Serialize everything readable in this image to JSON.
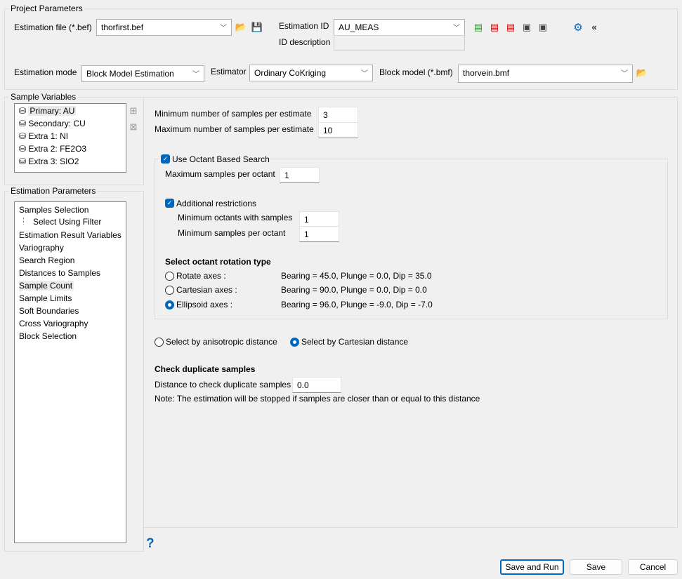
{
  "project": {
    "title": "Project Parameters",
    "estimation_file_label": "Estimation file (*.bef)",
    "estimation_file": "thorfirst.bef",
    "estimation_id_label": "Estimation ID",
    "estimation_id": "AU_MEAS",
    "id_description_label": "ID description",
    "id_description": "",
    "estimation_mode_label": "Estimation mode",
    "estimation_mode": "Block Model Estimation",
    "estimator_label": "Estimator",
    "estimator": "Ordinary CoKriging",
    "block_model_label": "Block model (*.bmf)",
    "block_model": "thorvein.bmf"
  },
  "sample_variables": {
    "title": "Sample Variables",
    "items": [
      "Primary: AU",
      "Secondary: CU",
      "Extra 1: NI",
      "Extra 2: FE2O3",
      "Extra 3: SIO2"
    ]
  },
  "estimation_parameters": {
    "title": "Estimation Parameters",
    "items": [
      "Samples Selection",
      "Select Using Filter",
      "Estimation Result Variables",
      "Variography",
      "Search Region",
      "Distances to Samples",
      "Sample Count",
      "Sample Limits",
      "Soft Boundaries",
      "Cross Variography",
      "Block Selection"
    ],
    "selected": "Sample Count"
  },
  "sample_count": {
    "min_samples_label": "Minimum number of samples per estimate",
    "min_samples": "3",
    "max_samples_label": "Maximum number of samples per estimate",
    "max_samples": "10",
    "octant_label": "Use Octant Based Search",
    "octant_checked": true,
    "max_per_octant_label": "Maximum samples per octant",
    "max_per_octant": "1",
    "additional_label": "Additional restrictions",
    "additional_checked": true,
    "min_octants_label": "Minimum octants with samples",
    "min_octants": "1",
    "min_per_octant_label": "Minimum samples per octant",
    "min_per_octant": "1",
    "rotation_heading": "Select octant rotation type",
    "rotation_options": [
      {
        "label": "Rotate axes :",
        "value": "Bearing = 45.0, Plunge = 0.0, Dip = 35.0",
        "selected": false
      },
      {
        "label": "Cartesian axes :",
        "value": "Bearing = 90.0, Plunge = 0.0, Dip = 0.0",
        "selected": false
      },
      {
        "label": "Ellipsoid axes :",
        "value": "Bearing = 96.0, Plunge = -9.0, Dip = -7.0",
        "selected": true
      }
    ],
    "distance_options": [
      {
        "label": "Select by anisotropic distance",
        "selected": false
      },
      {
        "label": "Select by Cartesian distance",
        "selected": true
      }
    ],
    "duplicate_heading": "Check duplicate samples",
    "duplicate_label": "Distance to check duplicate samples",
    "duplicate_value": "0.0",
    "note": "Note: The estimation will be stopped if samples are closer than or equal to this distance"
  },
  "help": "?",
  "buttons": {
    "save_run": "Save and Run",
    "save": "Save",
    "cancel": "Cancel"
  }
}
